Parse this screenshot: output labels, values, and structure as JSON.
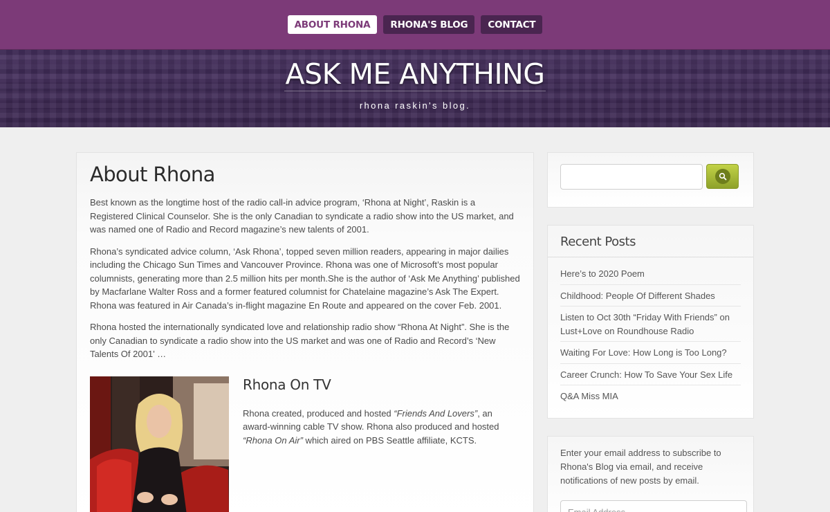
{
  "nav": {
    "items": [
      {
        "label": "ABOUT RHONA",
        "active": true
      },
      {
        "label": "RHONA'S BLOG",
        "active": false
      },
      {
        "label": "CONTACT",
        "active": false
      }
    ]
  },
  "header": {
    "title": "ASK ME ANYTHING",
    "tagline": "rhona raskin's blog."
  },
  "main": {
    "title": "About Rhona",
    "paragraphs": [
      "Best known as the longtime host of the radio call-in advice program, ‘Rhona at Night’, Raskin is a Registered Clinical Counselor. She is the only Canadian to syndicate a radio show into the US market, and was named one of Radio and Record magazine’s new talents of 2001.",
      "Rhona’s syndicated advice column, ‘Ask Rhona’, topped seven million readers, appearing in major dailies including the Chicago Sun Times and Vancouver Province. Rhona was one of Microsoft’s most popular columnists, generating more than 2.5 million hits per month.She is the author of ‘Ask Me Anything’ published by Macfarlane Walter Ross and a former featured columnist for Chatelaine magazine’s Ask The Expert. Rhona was featured in Air Canada’s in-flight magazine En Route and appeared on the cover Feb. 2001.",
      "Rhona hosted the internationally syndicated love and relationship radio show “Rhona At Night”. She is the only Canadian to syndicate a radio show into the US market and was one of Radio and Record’s ‘New Talents Of 2001’ …"
    ],
    "tv": {
      "heading": "Rhona On TV",
      "text_before": "Rhona created, produced and hosted ",
      "show1": "“Friends And Lovers”",
      "text_middle": ", an award-winning cable TV show. Rhona also produced and hosted ",
      "show2": "“Rhona On Air”",
      "text_after": " which aired on PBS Seattle affiliate, KCTS."
    }
  },
  "sidebar": {
    "search": {
      "value": "",
      "placeholder": ""
    },
    "recent_posts": {
      "title": "Recent Posts",
      "items": [
        "Here’s to 2020 Poem",
        "Childhood: People Of Different Shades",
        "Listen to Oct 30th “Friday With Friends” on Lust+Love on Roundhouse Radio",
        "Waiting For Love: How Long is Too Long?",
        "Career Crunch: How To Save Your Sex Life",
        "Q&A Miss MIA"
      ]
    },
    "subscribe": {
      "text": "Enter your email address to subscribe to Rhona's Blog via email, and receive notifications of new posts by email.",
      "email_placeholder": "Email Address"
    }
  },
  "colors": {
    "nav_bg": "#7c3a78",
    "nav_button": "#4a2550",
    "header_bg": "#3f2a57",
    "search_button": "#a9bb34"
  }
}
